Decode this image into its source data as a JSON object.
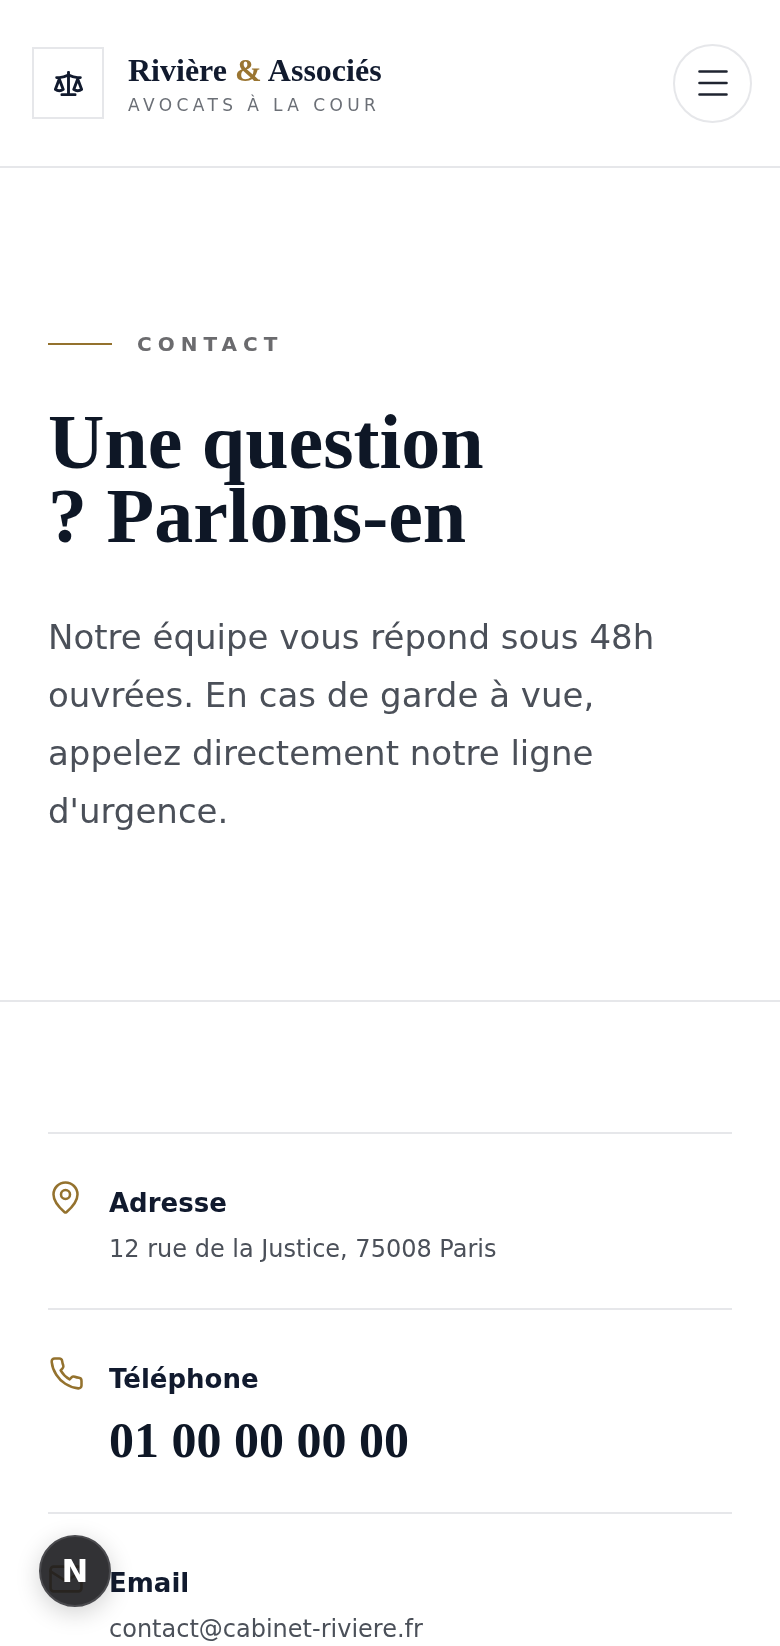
{
  "header": {
    "brand": {
      "name_parts": [
        {
          "text": "Rivière",
          "accent": false
        },
        {
          "text": "&",
          "accent": true
        },
        {
          "text": "Associés",
          "accent": false
        }
      ],
      "tagline": "AVOCATS À LA COUR"
    }
  },
  "hero": {
    "eyebrow": "CONTACT",
    "title": "Une question ? Parlons-en",
    "text": "Notre équipe vous répond sous 48h ouvrées. En cas de garde à vue, appelez directement notre ligne d'urgence."
  },
  "contact_items": [
    {
      "kind": "address",
      "label": "Adresse",
      "value": "12 rue de la Justice, 75008 Paris"
    },
    {
      "kind": "phone",
      "label": "Téléphone",
      "value": "01 00 00 00 00"
    },
    {
      "kind": "email",
      "label": "Email",
      "value": "contact@cabinet-riviere.fr"
    }
  ],
  "dev_indicator": {
    "label": "N"
  }
}
